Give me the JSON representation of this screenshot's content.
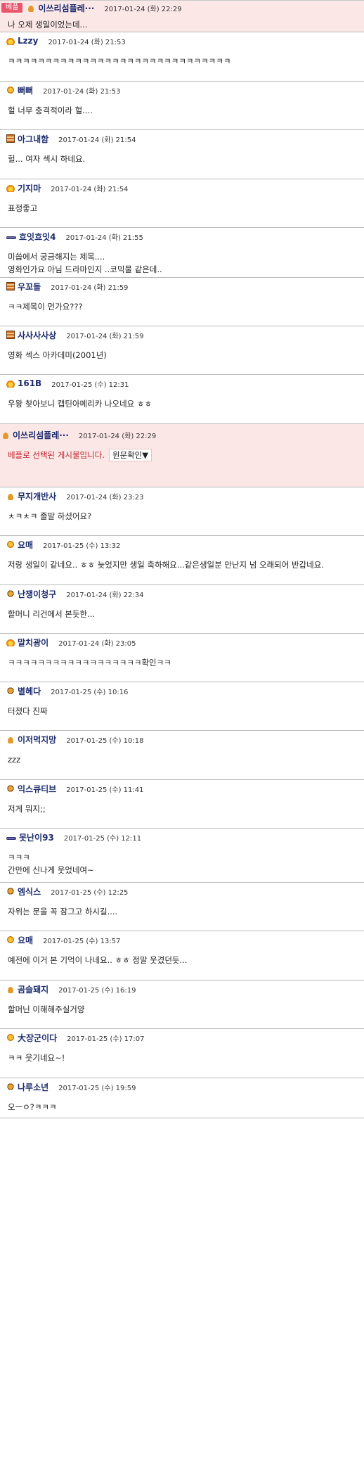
{
  "best_label": "베플",
  "best_comment": {
    "nick": "이쓰리섬플레···",
    "date": "2017-01-24 (화) 22:29",
    "text": "나 오제 생일이었는데..."
  },
  "comments": [
    {
      "nick": "Lzzy",
      "date": "2017-01-24 (화) 21:53",
      "lines": [
        "ㅋㅋㅋㅋㅋㅋㅋㅋㅋㅋㅋㅋㅋㅋㅋㅋㅋㅋㅋㅋㅋㅋㅋㅋㅋㅋㅋㅋㅋㅋ"
      ],
      "icon": "flame-icon"
    },
    {
      "nick": "뻐뻐",
      "date": "2017-01-24 (화) 21:53",
      "lines": [
        "헐 너무 충격적이라 헐...."
      ],
      "icon": "sun-icon"
    },
    {
      "nick": "아그내함",
      "date": "2017-01-24 (화) 21:54",
      "lines": [
        "헐... 여자 섹시 하네요."
      ],
      "icon": "stack-icon"
    },
    {
      "nick": "기지마",
      "date": "2017-01-24 (화) 21:54",
      "lines": [
        "표정좋고"
      ],
      "icon": "flame-icon"
    },
    {
      "nick": "흐잇흐잇4",
      "date": "2017-01-24 (화) 21:55",
      "lines": [
        "미씁에서 궁금해지는 제목....",
        "영화인가요 아님 드라마인지 ..코믹물 같은데.."
      ],
      "icon": "bar-icon"
    },
    {
      "nick": "우꼬돌",
      "date": "2017-01-24 (화) 21:59",
      "lines": [
        "ㅋㅋ제목이 먼가요???"
      ],
      "icon": "stack-icon"
    },
    {
      "nick": "사사사사상",
      "date": "2017-01-24 (화) 21:59",
      "lines": [
        "영화 섹스 아카데미(2001년)"
      ],
      "icon": "stack-icon"
    },
    {
      "nick": "161B",
      "date": "2017-01-25 (수) 12:31",
      "lines": [
        "우왕 찾아보니 캡틴아메리카 나오네요 ㅎㅎ"
      ],
      "icon": "flame-icon"
    },
    {
      "nick": "이쓰리섬플레···",
      "date": "2017-01-24 (화) 22:29",
      "notice": true,
      "icon": "wing-icon"
    },
    {
      "nick": "무지개반사",
      "date": "2017-01-24 (화) 23:23",
      "lines": [
        "ㅊㅋㅊㅋ 졸말 하셨어요?"
      ],
      "icon": "wing-icon"
    },
    {
      "nick": "요매",
      "date": "2017-01-25 (수) 13:32",
      "lines": [
        "저랑 생일이 같네요.. ㅎㅎ 늦었지만 생일 축하해요...같은생일분 만난지 넘 오래되어 반갑네요."
      ],
      "icon": "sun-icon"
    },
    {
      "nick": "난쟁이청구",
      "date": "2017-01-24 (화) 22:34",
      "lines": [
        "할머니 리건에서 본듯한..."
      ],
      "icon": "gem-icon"
    },
    {
      "nick": "말치광이",
      "date": "2017-01-24 (화) 23:05",
      "lines": [
        "ㅋㅋㅋㅋㅋㅋㅋㅋㅋㅋㅋㅋㅋㅋㅋㅋㅋㅋ확인ㅋㅋ"
      ],
      "icon": "flame-icon"
    },
    {
      "nick": "별헤다",
      "date": "2017-01-25 (수) 10:16",
      "lines": [
        "터졌다 진짜"
      ],
      "icon": "gem-icon"
    },
    {
      "nick": "이저먹지망",
      "date": "2017-01-25 (수) 10:18",
      "lines": [
        "zzz"
      ],
      "icon": "wing-icon"
    },
    {
      "nick": "익스큐티브",
      "date": "2017-01-25 (수) 11:41",
      "lines": [
        "저게 뭐지;;"
      ],
      "icon": "gem-icon"
    },
    {
      "nick": "못난이93",
      "date": "2017-01-25 (수) 12:11",
      "lines": [
        "ㅋㅋㅋ",
        "간만에 신나게 웃었네여~"
      ],
      "icon": "bar-icon"
    },
    {
      "nick": "엠식스",
      "date": "2017-01-25 (수) 12:25",
      "lines": [
        "자위는 문을 꼭 잠그고 하시길...."
      ],
      "icon": "gem-icon"
    },
    {
      "nick": "요매",
      "date": "2017-01-25 (수) 13:57",
      "lines": [
        "예전에 이거 본 기억이 나네요.. ㅎㅎ 정말 웃겼던듯..."
      ],
      "icon": "sun-icon"
    },
    {
      "nick": "곰슬돼지",
      "date": "2017-01-25 (수) 16:19",
      "lines": [
        "할머닌 이해해주실거양"
      ],
      "icon": "wing-icon"
    },
    {
      "nick": "大장군이다",
      "date": "2017-01-25 (수) 17:07",
      "lines": [
        "ㅋㅋ 웃기네요~!"
      ],
      "icon": "sun-icon"
    },
    {
      "nick": "나루소년",
      "date": "2017-01-25 (수) 19:59",
      "lines": [
        "오ㅡㅇ?ㅋㅋㅋ"
      ],
      "icon": "gem-icon"
    }
  ],
  "notice": {
    "text": "베플로 선택된 게시물입니다.",
    "origin_label": "원문확인▼"
  },
  "colors": {
    "best_bg": "#fce7e7",
    "badge": "#e9556b",
    "nick": "#1d2d6e",
    "notice": "#c0222b"
  }
}
